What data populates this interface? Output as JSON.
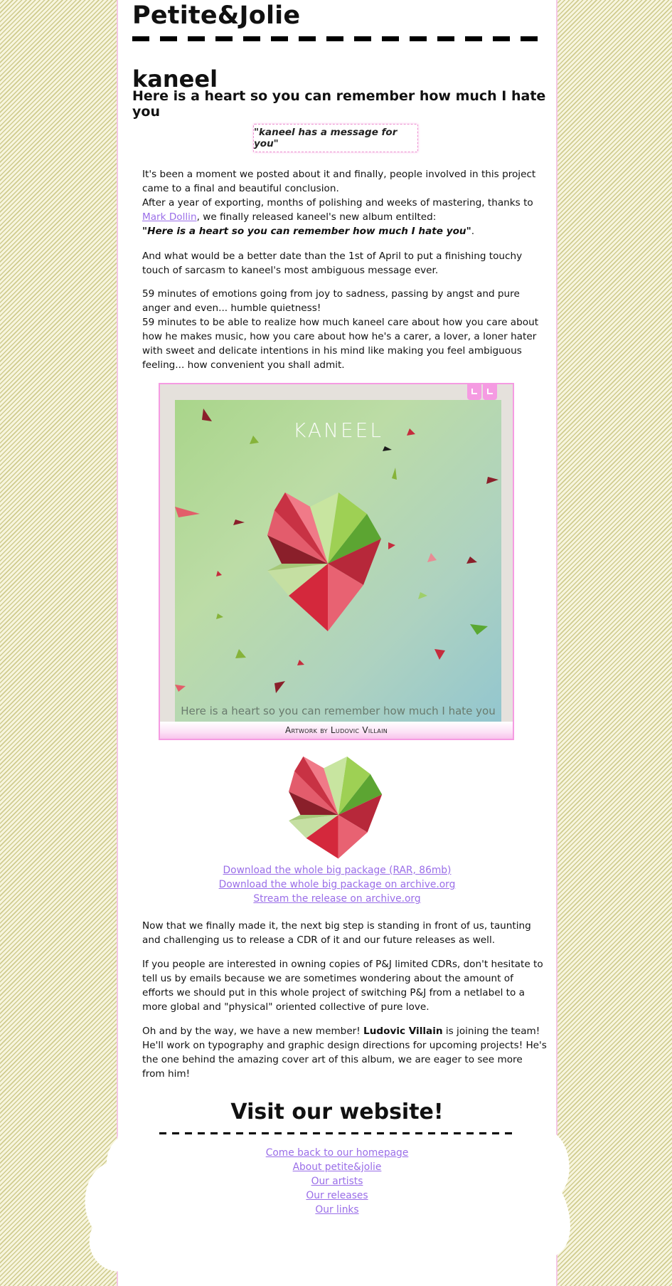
{
  "site": {
    "title": "Petite&Jolie"
  },
  "post": {
    "title": "kaneel",
    "subtitle": "Here is a heart so you can remember how much I hate you",
    "quote": "\"kaneel has a message for you\"",
    "p1_a": "It's been a moment we posted about it and finally, people involved in this project came to a final and beautiful conclusion.",
    "p1_b": "After a year of exporting, months of polishing and weeks of mastering, thanks to ",
    "p1_link": "Mark Dollin",
    "p1_c": ", we finally released kaneel's new album entilted:",
    "p1_album": "\"Here is a heart so you can remember how much I hate you\"",
    "p1_end": ".",
    "p2": "And what would be a better date than the 1st of April to put a finishing touchy touch of sarcasm to kaneel's most ambiguous message ever.",
    "p3_a": "59 minutes of emotions going from joy to sadness, passing by angst and pure anger and even... humble quietness!",
    "p3_b": "59 minutes to be able to realize how much kaneel care about how you care about how he makes music, how you care about how he's a carer, a lover, a loner hater with sweet and delicate intentions in his mind like making you feel ambiguous feeling... how convenient you shall admit.",
    "p4": "Now that we finally made it, the next big step is standing in front of us, taunting and challenging us to release a CDR of it and our future releases as well.",
    "p5": "If you people are interested in owning copies of P&J limited CDRs, don't hesitate to tell us by emails because we are sometimes wondering about the amount of efforts we should put in this whole project of switching P&J from a netlabel to a more global and \"physical\" oriented collective of pure love.",
    "p6_a": "Oh and by the way, we have a new member! ",
    "p6_name": "Ludovic Villain",
    "p6_b": " is joining the team!",
    "p6_c": "He'll work on typography and graphic design directions for upcoming projects! He's the one behind the amazing cover art of this album, we are eager to see more from him!"
  },
  "artwork": {
    "cover_title": "KANEEL",
    "cover_tagline": "Here is a heart so you can remember how much I hate you",
    "caption": "Artwork by Ludovic Villain",
    "icon_names": [
      "corner-fold-icon",
      "corner-fold-icon"
    ]
  },
  "downloads": [
    "Download the whole big package (RAR, 86mb)",
    "Download the whole big package on archive.org",
    "Stream the release on archive.org"
  ],
  "footer": {
    "title": "Visit our website!",
    "links": [
      "Come back to our homepage",
      "About petite&jolie",
      "Our artists",
      "Our releases",
      "Our links"
    ]
  },
  "colors": {
    "accent_pink": "#f59be2",
    "link": "#9a6ee8",
    "heart_red": "#d4283c",
    "heart_green": "#7fbf3a"
  }
}
